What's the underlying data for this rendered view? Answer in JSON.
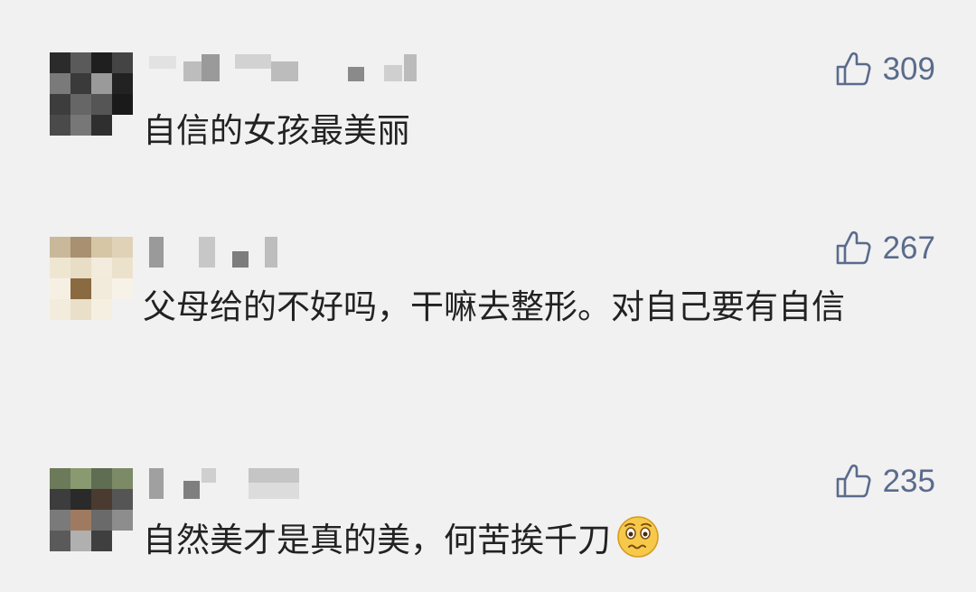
{
  "comments": [
    {
      "likes": "309",
      "text": "自信的女孩最美丽"
    },
    {
      "likes": "267",
      "text": "父母给的不好吗，干嘛去整形。对自己要有自信"
    },
    {
      "likes": "235",
      "text": "自然美才是真的美，何苦挨千刀",
      "emoji": "woozy-face-emoji"
    }
  ],
  "icons": {
    "like": "thumbs-up-icon"
  },
  "colors": {
    "like": "#5a6b8c",
    "text": "#222222",
    "background": "#f1f1f1"
  }
}
